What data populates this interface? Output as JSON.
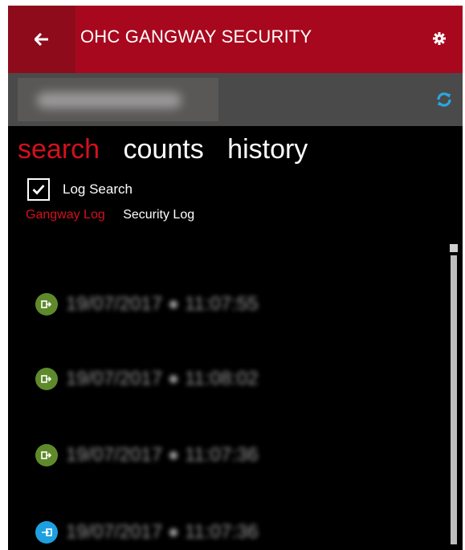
{
  "header": {
    "title": "OHC GANGWAY SECURITY",
    "color": "#a8081e",
    "back_color": "#8e0b1c"
  },
  "subbar": {
    "user_name": "",
    "refresh_icon": "refresh-icon"
  },
  "pivot": {
    "tabs": [
      {
        "label": "search",
        "active": true
      },
      {
        "label": "counts",
        "active": false
      },
      {
        "label": "history",
        "active": false
      }
    ]
  },
  "log_search": {
    "label": "Log Search",
    "checked": true
  },
  "log_tabs": [
    {
      "label": "Gangway Log",
      "active": true
    },
    {
      "label": "Security Log",
      "active": false
    }
  ],
  "entries": [
    {
      "text": "19/07/2017 ● 11:07:55",
      "icon": "log-in-icon",
      "color": "#5f8a2c"
    },
    {
      "text": "19/07/2017 ● 11:08:02",
      "icon": "log-in-icon",
      "color": "#5f8a2c"
    },
    {
      "text": "19/07/2017 ● 11:07:36",
      "icon": "log-in-icon",
      "color": "#5f8a2c"
    },
    {
      "text": "19/07/2017 ● 11:07:36",
      "icon": "log-out-icon",
      "color": "#1ea0e0"
    }
  ],
  "colors": {
    "accent": "#d4101d",
    "background": "#000000",
    "subbar": "#4a4a4a"
  }
}
